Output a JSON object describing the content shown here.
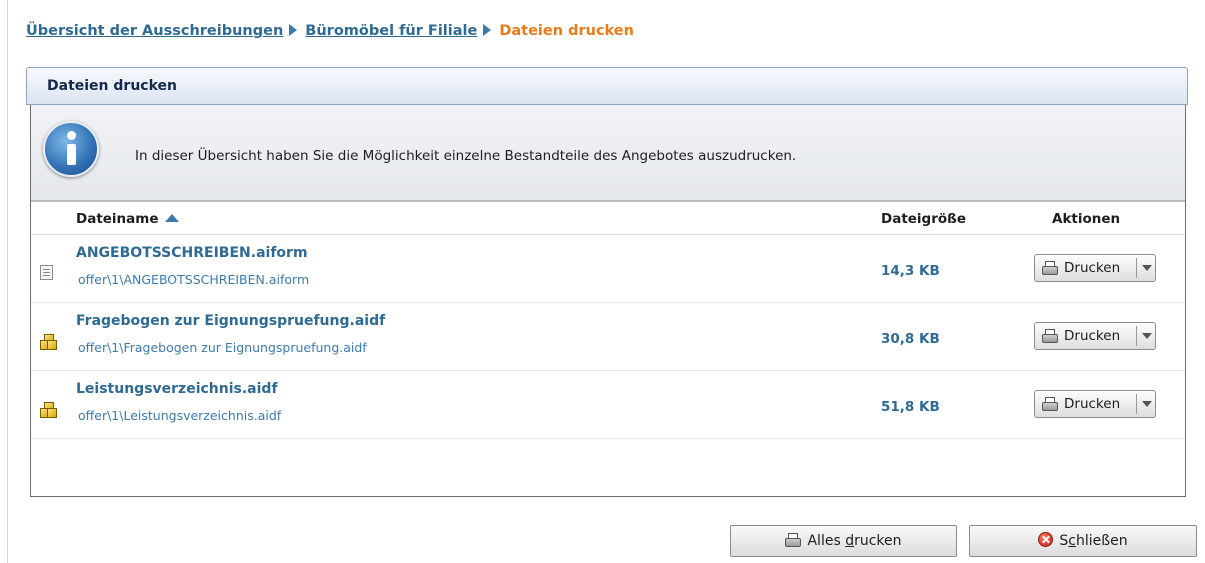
{
  "breadcrumb": {
    "items": [
      "Übersicht der Ausschreibungen",
      "Büromöbel für Filiale"
    ],
    "current": "Dateien drucken"
  },
  "panel": {
    "title": "Dateien drucken",
    "info_text": "In dieser Übersicht haben Sie die Möglichkeit einzelne Bestandteile des Angebotes auszudrucken."
  },
  "table": {
    "columns": {
      "name": "Dateiname",
      "size": "Dateigröße",
      "actions": "Aktionen"
    },
    "sort": {
      "column": "Dateiname",
      "direction": "ascending"
    },
    "rows": [
      {
        "name": "ANGEBOTSSCHREIBEN.aiform",
        "path": "offer\\1\\ANGEBOTSSCHREIBEN.aiform",
        "size": "14,3 KB",
        "icon": "form-document-icon",
        "action": "Drucken"
      },
      {
        "name": "Fragebogen zur Eignungspruefung.aidf",
        "path": "offer\\1\\Fragebogen zur Eignungspruefung.aidf",
        "size": "30,8 KB",
        "icon": "cubes-file-icon",
        "action": "Drucken"
      },
      {
        "name": "Leistungsverzeichnis.aidf",
        "path": "offer\\1\\Leistungsverzeichnis.aidf",
        "size": "51,8 KB",
        "icon": "cubes-file-icon",
        "action": "Drucken"
      }
    ]
  },
  "footer": {
    "print_all_pre": "Alles ",
    "print_all_mnemonic": "d",
    "print_all_post": "rucken",
    "close_pre": "S",
    "close_mnemonic": "c",
    "close_post": "hließen"
  },
  "colors": {
    "link": "#2f6a93",
    "current": "#e87b1a",
    "header_bg": "#dce4f2"
  }
}
